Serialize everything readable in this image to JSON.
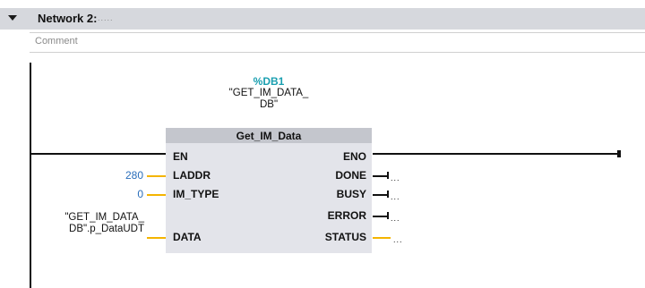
{
  "network": {
    "title": "Network 2:",
    "description": ".....",
    "comment": "Comment"
  },
  "block": {
    "instance_db_address": "%DB1",
    "instance_db_name": "\"GET_IM_DATA_\nDB\"",
    "title": "Get_IM_Data",
    "inputs": {
      "en": "EN",
      "laddr": "LADDR",
      "im_type": "IM_TYPE",
      "data": "DATA"
    },
    "outputs": {
      "eno": "ENO",
      "done": "DONE",
      "busy": "BUSY",
      "error": "ERROR",
      "status": "STATUS"
    }
  },
  "params": {
    "laddr_value": "280",
    "im_type_value": "0",
    "data_tag": "\"GET_IM_DATA_\nDB\".p_DataUDT",
    "done_value": "...",
    "busy_value": "...",
    "error_value": "...",
    "status_value": "..."
  },
  "colors": {
    "header_bg": "#d6d8dd",
    "block_body": "#e3e4ea",
    "block_title_bar": "#c4c6cd",
    "db_address": "#1a9fb0",
    "constant_value": "#2a6ebb",
    "unconnected_stub": "#f4b400"
  },
  "icons": {
    "collapse": "triangle-down"
  }
}
